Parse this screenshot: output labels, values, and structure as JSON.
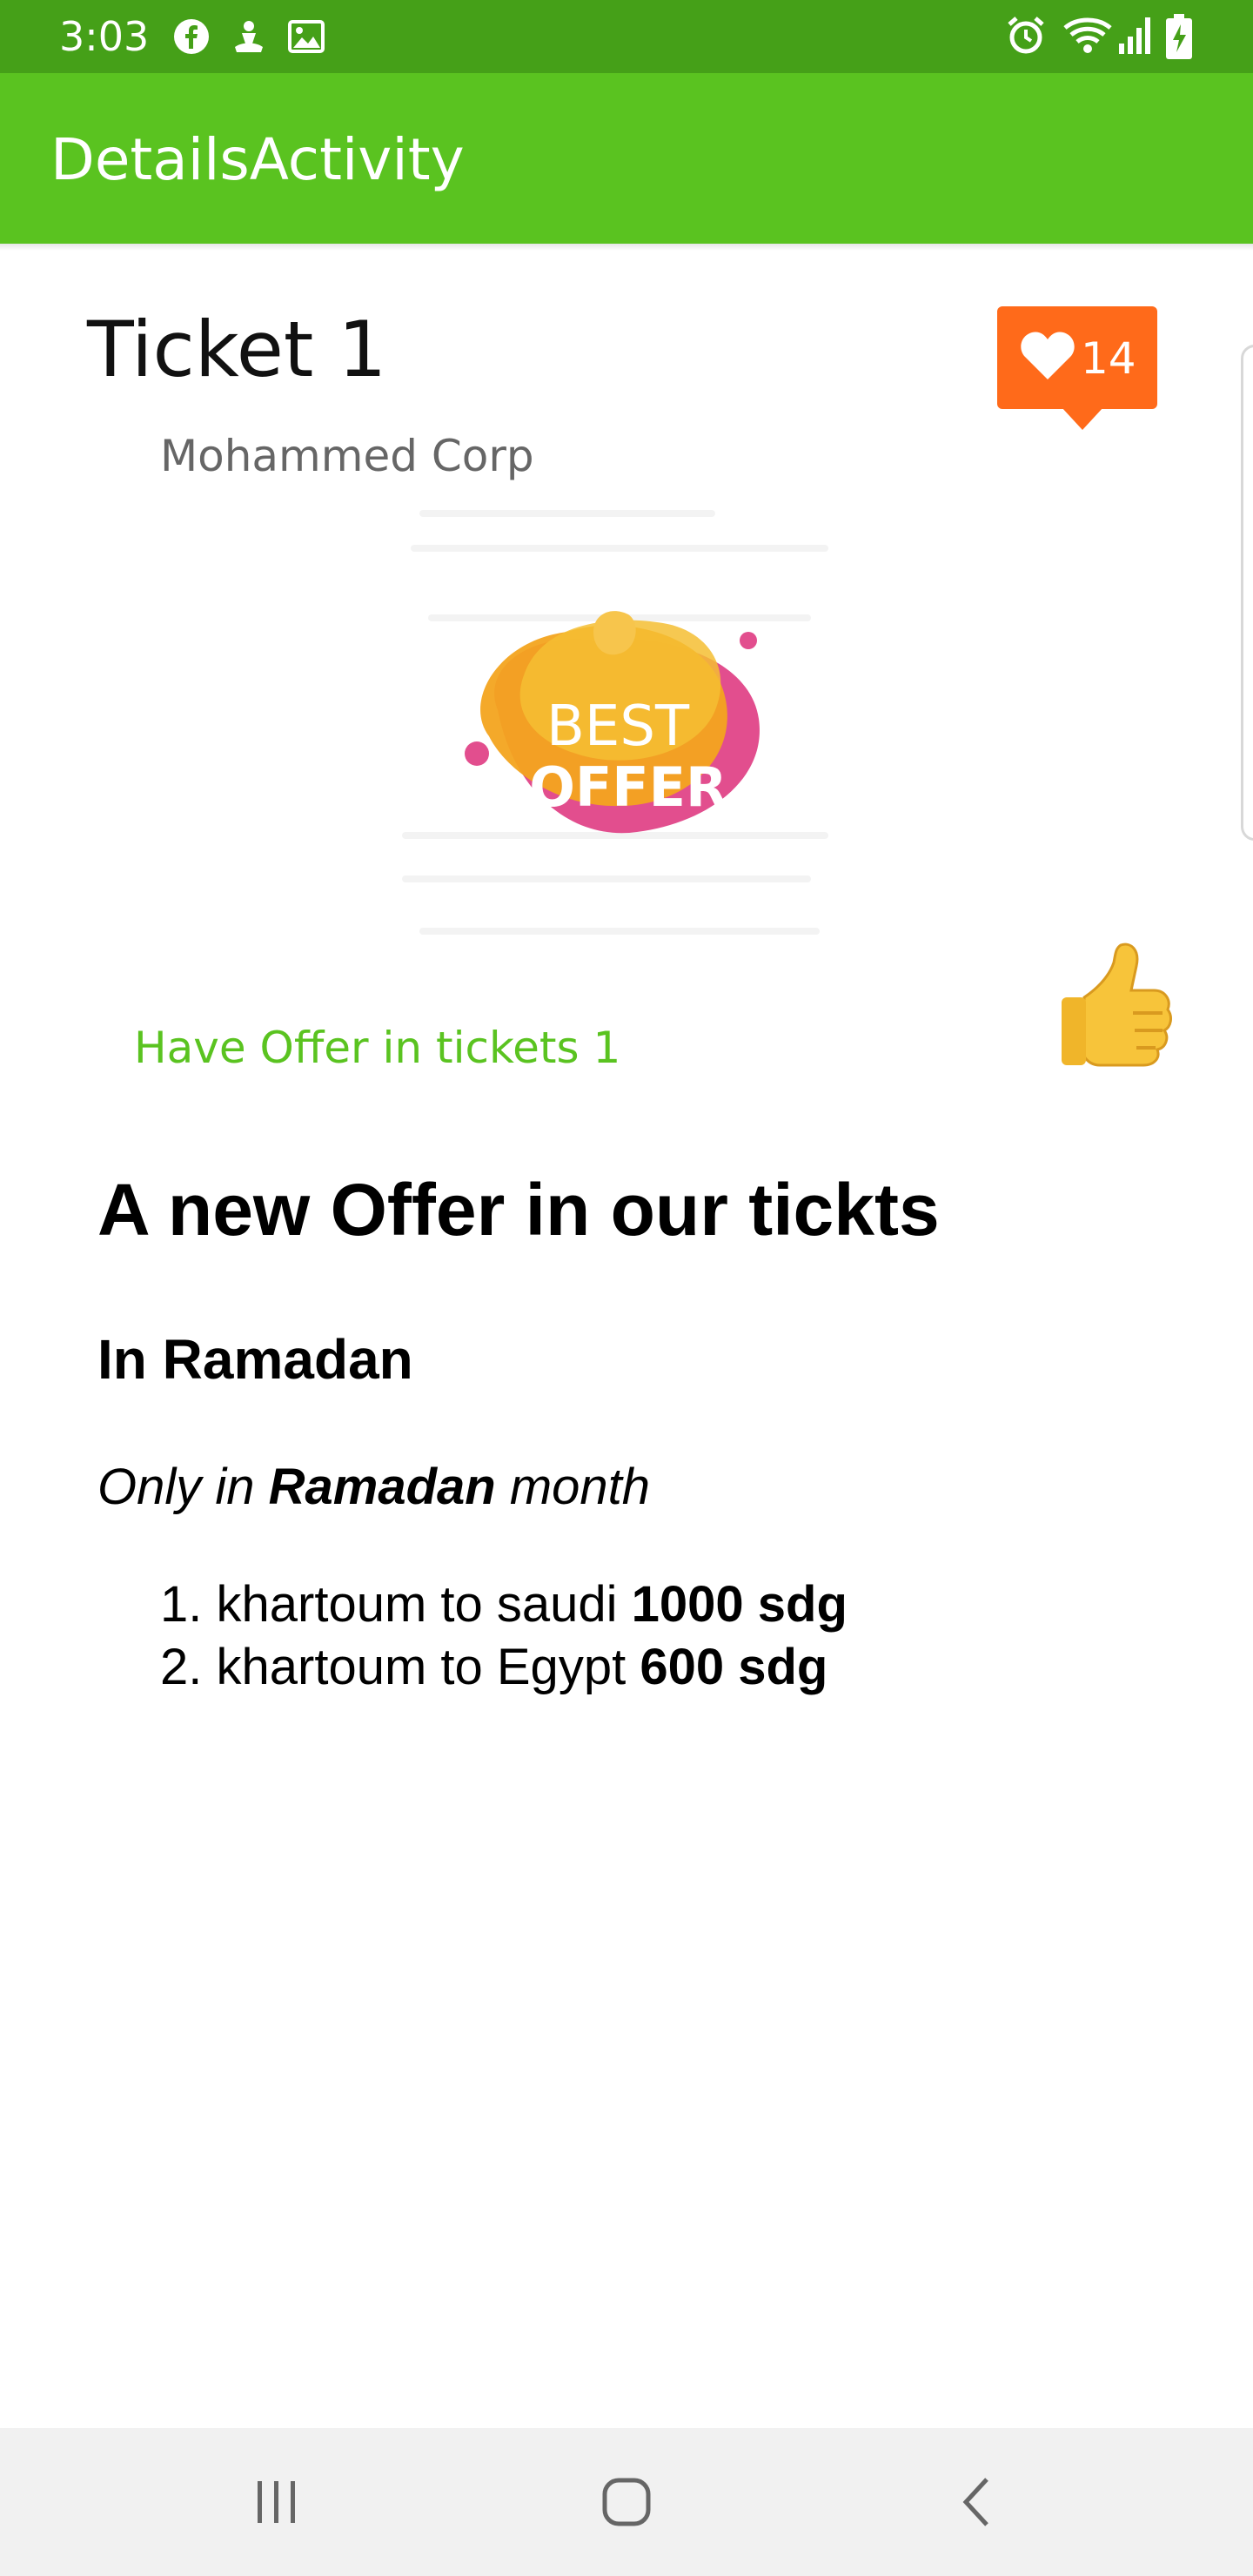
{
  "status_bar": {
    "time": "3:03",
    "icons_left": [
      "facebook-icon",
      "download-icon",
      "image-icon"
    ],
    "icons_right": [
      "alarm-icon",
      "wifi-icon",
      "signal-icon",
      "battery-charging-icon"
    ]
  },
  "toolbar": {
    "title": "DetailsActivity"
  },
  "ticket": {
    "title": "Ticket 1",
    "company": "Mohammed Corp",
    "like_count": "14"
  },
  "offer_image": {
    "line1": "BEST",
    "line2": "OFFER"
  },
  "offer_caption": "Have Offer in tickets 1",
  "content": {
    "heading": "A new Offer in our tickts",
    "subheading": "In Ramadan",
    "italic_prefix": "Only in ",
    "italic_bold": "Ramadan",
    "italic_suffix": " month",
    "list": [
      {
        "number": "1.",
        "text": "khartoum to saudi ",
        "bold": "1000 sdg"
      },
      {
        "number": "2.",
        "text": "khartoum to Egypt ",
        "bold": "600 sdg"
      }
    ]
  },
  "colors": {
    "status_bar": "#45a018",
    "toolbar": "#5ac320",
    "accent_text": "#5ac320",
    "badge": "#ff6a1a"
  },
  "nav_bar": {
    "buttons": [
      "recents-icon",
      "home-icon",
      "back-icon"
    ]
  }
}
